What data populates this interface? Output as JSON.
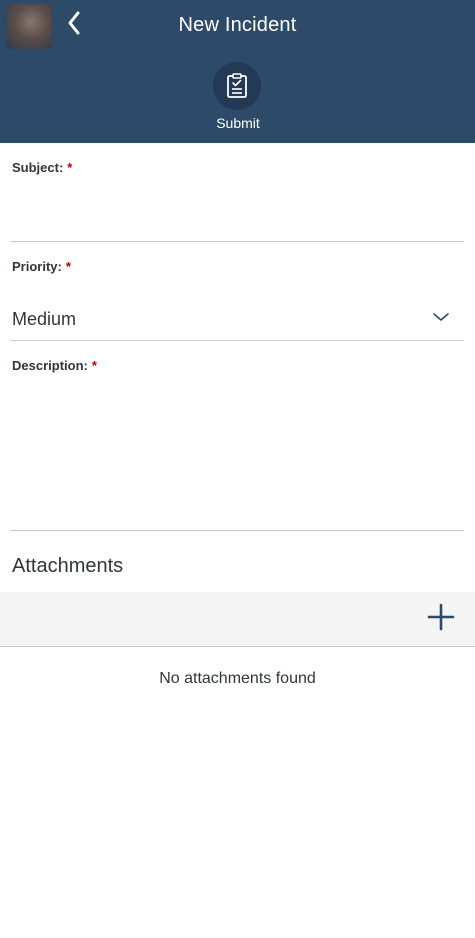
{
  "header": {
    "title": "New Incident",
    "submit_label": "Submit",
    "background_color": "#2d4a68"
  },
  "form": {
    "subject": {
      "label": "Subject:",
      "required_mark": "*",
      "value": ""
    },
    "priority": {
      "label": "Priority:",
      "required_mark": "*",
      "selected": "Medium"
    },
    "description": {
      "label": "Description:",
      "required_mark": "*",
      "value": ""
    }
  },
  "attachments": {
    "title": "Attachments",
    "empty_text": "No attachments found"
  },
  "icons": {
    "back": "chevron-left-icon",
    "submit": "clipboard-check-icon",
    "dropdown": "chevron-down-icon",
    "add": "plus-icon"
  },
  "colors": {
    "required": "#bb0000",
    "accent": "#2d4a68"
  }
}
